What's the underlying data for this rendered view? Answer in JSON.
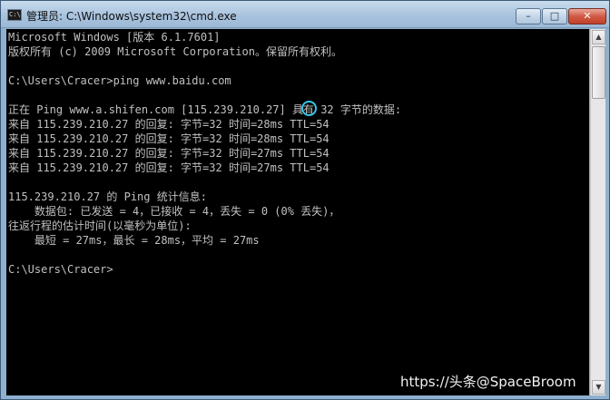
{
  "window": {
    "title": "管理员: C:\\Windows\\system32\\cmd.exe",
    "icon": "C:\\",
    "buttons": {
      "minimize": "–",
      "maximize": "□",
      "close": "✕"
    }
  },
  "console": {
    "lines": [
      "Microsoft Windows [版本 6.1.7601]",
      "版权所有 (c) 2009 Microsoft Corporation。保留所有权利。",
      "",
      "C:\\Users\\Cracer>ping www.baidu.com",
      "",
      "正在 Ping www.a.shifen.com [115.239.210.27] 具有 32 字节的数据:",
      "来自 115.239.210.27 的回复: 字节=32 时间=28ms TTL=54",
      "来自 115.239.210.27 的回复: 字节=32 时间=28ms TTL=54",
      "来自 115.239.210.27 的回复: 字节=32 时间=27ms TTL=54",
      "来自 115.239.210.27 的回复: 字节=32 时间=27ms TTL=54",
      "",
      "115.239.210.27 的 Ping 统计信息:",
      "    数据包: 已发送 = 4，已接收 = 4，丢失 = 0 (0% 丢失)，",
      "往返行程的估计时间(以毫秒为单位):",
      "    最短 = 27ms，最长 = 28ms，平均 = 27ms",
      "",
      "C:\\Users\\Cracer>"
    ]
  },
  "scrollbar": {
    "up": "▲",
    "down": "▼"
  },
  "watermark": "https://头条@SpaceBroom"
}
